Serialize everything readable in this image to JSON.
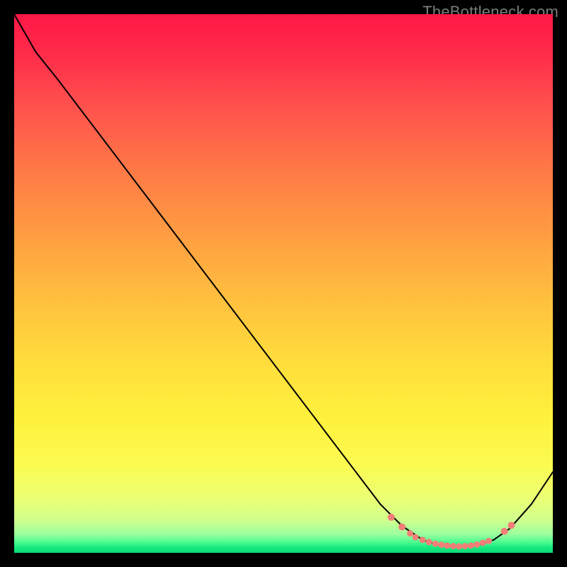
{
  "watermark": "TheBottleneck.com",
  "colors": {
    "curve_stroke": "#000000",
    "marker_fill": "#f47f78",
    "marker_stroke": "#f47f78"
  },
  "chart_data": {
    "type": "line",
    "title": "",
    "xlabel": "",
    "ylabel": "",
    "xlim": [
      0,
      100
    ],
    "ylim": [
      0,
      100
    ],
    "curve": [
      {
        "x": 0,
        "y": 100
      },
      {
        "x": 4,
        "y": 93
      },
      {
        "x": 8,
        "y": 88
      },
      {
        "x": 68,
        "y": 9
      },
      {
        "x": 72,
        "y": 5
      },
      {
        "x": 76,
        "y": 2.3
      },
      {
        "x": 79,
        "y": 1.4
      },
      {
        "x": 82,
        "y": 1.2
      },
      {
        "x": 86,
        "y": 1.4
      },
      {
        "x": 89,
        "y": 2.4
      },
      {
        "x": 92,
        "y": 4.5
      },
      {
        "x": 96,
        "y": 9
      },
      {
        "x": 100,
        "y": 15
      }
    ],
    "markers": [
      {
        "x": 70,
        "y": 6.6,
        "r": 4.5
      },
      {
        "x": 72,
        "y": 4.8,
        "r": 4.5
      },
      {
        "x": 73.5,
        "y": 3.6,
        "r": 4.0
      },
      {
        "x": 74.5,
        "y": 2.9,
        "r": 4.0
      },
      {
        "x": 75.8,
        "y": 2.4,
        "r": 4.0
      },
      {
        "x": 77.0,
        "y": 2.0,
        "r": 4.0
      },
      {
        "x": 78.2,
        "y": 1.7,
        "r": 4.0
      },
      {
        "x": 79.3,
        "y": 1.5,
        "r": 4.0
      },
      {
        "x": 80.4,
        "y": 1.35,
        "r": 4.0
      },
      {
        "x": 81.5,
        "y": 1.25,
        "r": 4.0
      },
      {
        "x": 82.6,
        "y": 1.2,
        "r": 4.0
      },
      {
        "x": 83.7,
        "y": 1.25,
        "r": 4.0
      },
      {
        "x": 84.8,
        "y": 1.35,
        "r": 4.0
      },
      {
        "x": 85.9,
        "y": 1.55,
        "r": 4.0
      },
      {
        "x": 87.0,
        "y": 1.85,
        "r": 4.0
      },
      {
        "x": 88.1,
        "y": 2.2,
        "r": 4.0
      },
      {
        "x": 91.0,
        "y": 4.0,
        "r": 4.5
      },
      {
        "x": 92.3,
        "y": 5.1,
        "r": 4.5
      }
    ]
  }
}
